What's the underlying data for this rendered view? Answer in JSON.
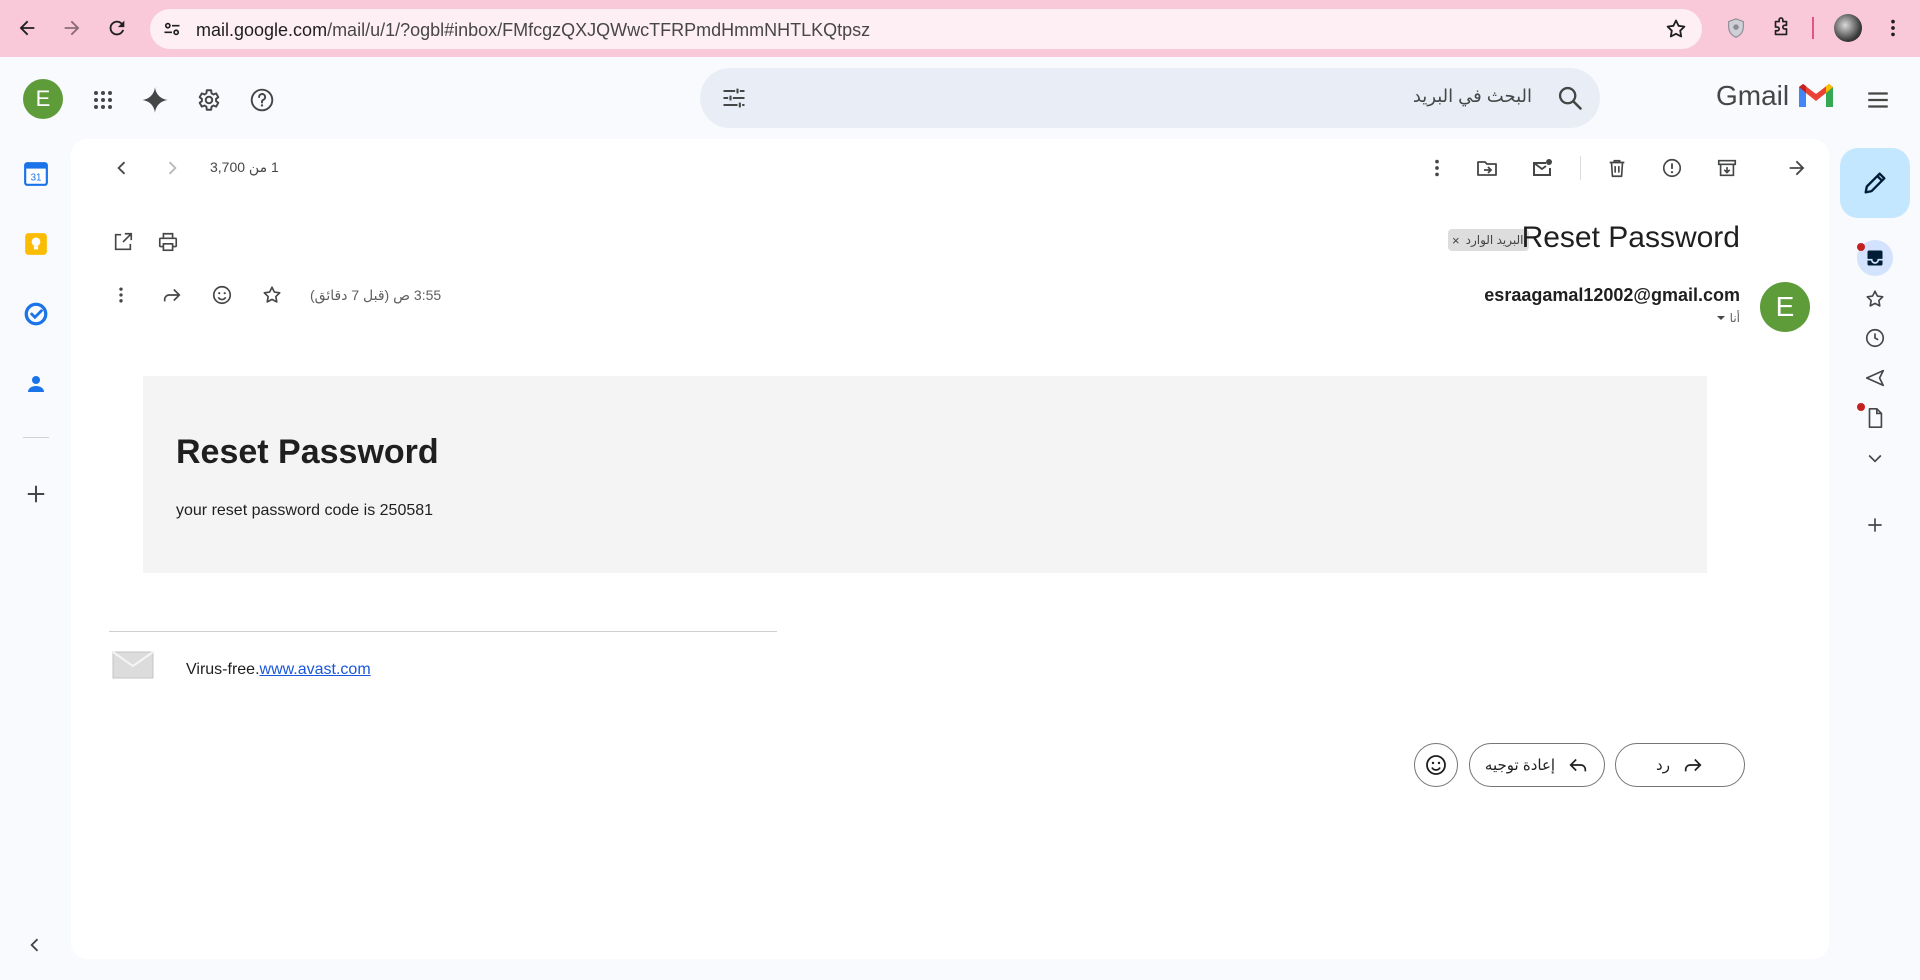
{
  "browser": {
    "url_host": "mail.google.com",
    "url_rest": "/mail/u/1/?ogbl#inbox/FMfcgzQXJQWwcTFRPmdHmmNHTLKQtpsz"
  },
  "header": {
    "user_initial": "E",
    "search_placeholder": "البحث في البريد",
    "logo_text": "Gmail"
  },
  "toolbar": {
    "pager_text": "1 من 3,700"
  },
  "message": {
    "subject": "Reset Password",
    "label": "البريد الوارد",
    "label_remove": "×",
    "sender_initial": "E",
    "sender_email": "esraagamal12002@gmail.com",
    "recipient": "أنا",
    "date": "3:55 ص (قبل 7 دقائق)",
    "body_title": "Reset Password",
    "body_text": "your reset password code is 250581",
    "virus_prefix": "Virus-free.",
    "virus_link": "www.avast.com"
  },
  "actions": {
    "reply_label": "رد",
    "forward_label": "إعادة توجيه"
  },
  "colors": {
    "chrome_pink": "#f9c8d9",
    "avatar_green": "#5e9c3a",
    "compose_blue": "#c2e7ff"
  }
}
